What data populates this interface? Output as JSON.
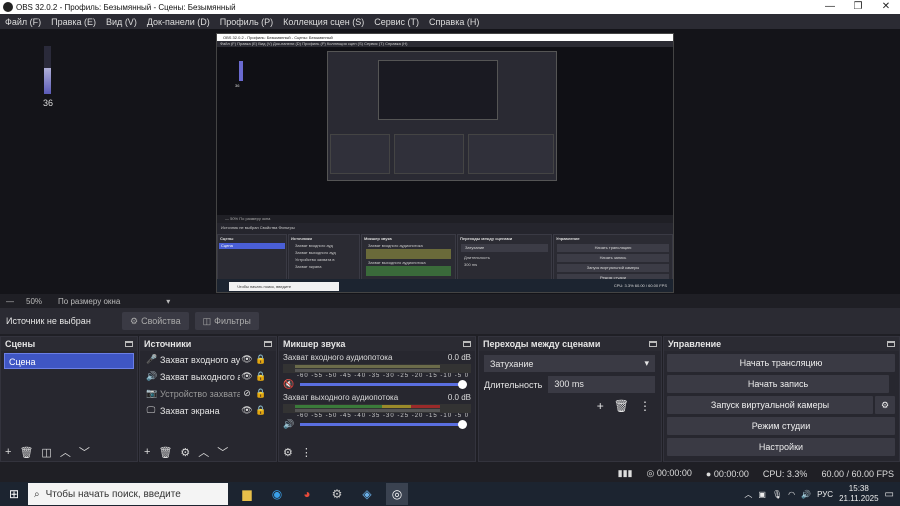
{
  "window": {
    "title": "OBS 32.0.2 - Профиль: Безымянный - Сцены: Безымянный",
    "controls": {
      "minimize": "—",
      "maximize": "❐",
      "close": "✕"
    }
  },
  "menu": [
    "Файл (F)",
    "Правка (E)",
    "Вид (V)",
    "Док-панели (D)",
    "Профиль (P)",
    "Коллекция сцен (S)",
    "Сервис (T)",
    "Справка (H)"
  ],
  "preview": {
    "meter_value": "36",
    "meter_level": 0.55,
    "nested": {
      "title": "OBS 32.0.2 - Профиль: Безымянный - Сцены: Безымянный",
      "menu": "Файл (F)  Правка (E)  Вид (V)  Док-панели (D)  Профиль (P)  Коллекция сцен (S)  Сервис (T)  Справка (H)",
      "meter_value": "36",
      "zoom": "— 50%  По размеру окна",
      "source_bar": "Источник не выбран     Свойства     Фильтры",
      "scenes_header": "Сцены",
      "scene": "Сцена",
      "sources_header": "Источники",
      "sources": [
        "Захват входного ауд",
        "Захват выходного ауд",
        "Устройство захвата в",
        "Захват экрана"
      ],
      "mixer_header": "Микшер звука",
      "mixer_items": [
        "Захват входного аудиопотока",
        "Захват выходного аудиопотока"
      ],
      "transitions_header": "Переходы между сценами",
      "transition": "Затухание",
      "duration_label": "Длительность",
      "duration": "300 ms",
      "controls_header": "Управление",
      "controls": [
        "Начать трансляцию",
        "Начать запись",
        "Запуск виртуальной камеры",
        "Режим студии",
        "Настройки"
      ],
      "status": "CPU: 3.3%    60.00 / 60.00 FPS",
      "search": "Чтобы начать поиск, введите"
    }
  },
  "zoom": {
    "minus": "—",
    "value": "50%",
    "fit": "По размеру окна",
    "arrow": "▾"
  },
  "source_bar": {
    "label": "Источник не выбран",
    "properties": "Свойства",
    "filters": "Фильтры"
  },
  "scenes": {
    "header": "Сцены",
    "items": [
      "Сцена"
    ],
    "footer": [
      "+",
      "🗑",
      "◫",
      "︿",
      "﹀"
    ]
  },
  "sources": {
    "header": "Источники",
    "items": [
      {
        "icon": "🎤",
        "name": "Захват входного ауди",
        "dim": false
      },
      {
        "icon": "🔊",
        "name": "Захват выходного ауди",
        "dim": false
      },
      {
        "icon": "📷",
        "name": "Устройство захвата ви",
        "dim": true
      },
      {
        "icon": "🖵",
        "name": "Захват экрана",
        "dim": false
      }
    ],
    "eye": "👁",
    "hidden_eye": "⊘",
    "lock": "🔒",
    "footer": [
      "+",
      "🗑",
      "⚙",
      "︿",
      "﹀"
    ]
  },
  "mixer": {
    "header": "Микшер звука",
    "ticks": "-60 -55 -50 -45 -40 -35 -30 -25 -20 -15 -10 -5 0",
    "items": [
      {
        "name": "Захват входного аудиопотока",
        "db": "0.0 dB",
        "speaker": "🔇",
        "color": "#d84a4a"
      },
      {
        "name": "Захват выходного аудиопотока",
        "db": "0.0 dB",
        "speaker": "🔊",
        "color": "#ffffff"
      }
    ],
    "footer": [
      "⚙",
      "⋮"
    ]
  },
  "transitions": {
    "header": "Переходы между сценами",
    "selected": "Затухание",
    "duration_label": "Длительность",
    "duration": "300 ms",
    "buttons": [
      "+",
      "🗑",
      "⋮"
    ]
  },
  "controls": {
    "header": "Управление",
    "buttons": [
      "Начать трансляцию",
      "Начать запись",
      "Запуск виртуальной камеры",
      "Режим студии",
      "Настройки"
    ],
    "gear": "⚙"
  },
  "status": {
    "stream_time": "00:00:00",
    "record_time": "00:00:00",
    "cpu": "CPU: 3.3%",
    "fps": "60.00 / 60.00 FPS"
  },
  "taskbar": {
    "search_placeholder": "Чтобы начать поиск, введите",
    "lang": "РУС",
    "time": "15:38",
    "date": "21.11.2025"
  },
  "colors": {
    "accent": "#4a5fd6",
    "bg": "#1f1f25",
    "dock": "#27272f"
  }
}
